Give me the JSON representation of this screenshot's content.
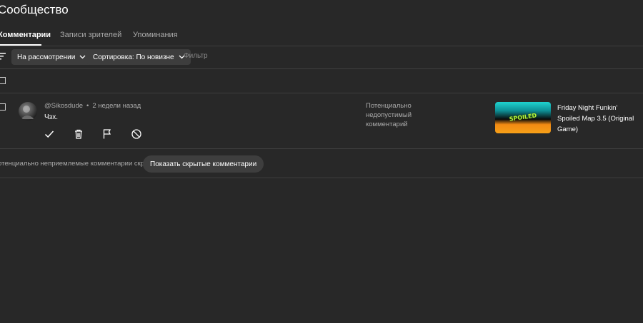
{
  "page": {
    "title": "Сообщество"
  },
  "tabs": [
    {
      "label": "Комментарии",
      "active": true
    },
    {
      "label": "Записи зрителей",
      "active": false
    },
    {
      "label": "Упоминания",
      "active": false
    }
  ],
  "filters": {
    "status_chip": "На рассмотрении",
    "sort_chip": "Сортировка: По новизне",
    "filter_placeholder": "Фильтр"
  },
  "comment": {
    "author": "@Sikosdude",
    "time": "2 недели назад",
    "text": "Чзх.",
    "status": "Потенциально недопустимый комментарий",
    "video_title": "Friday Night Funkin' Spoiled Map 3.5 (Original Game)",
    "thumbnail_logo": "SPOILED",
    "actions": [
      "check-icon",
      "trash-icon",
      "flag-icon",
      "block-icon"
    ]
  },
  "hidden_notice": {
    "text": "отенциально неприемлемые комментарии скрыты.",
    "button_label": "Показать скрытые комментарии"
  },
  "colors": {
    "background": "#282828",
    "chip": "#3d3d3d",
    "muted_text": "#aaaaaa",
    "divider": "#3e3e3e"
  }
}
